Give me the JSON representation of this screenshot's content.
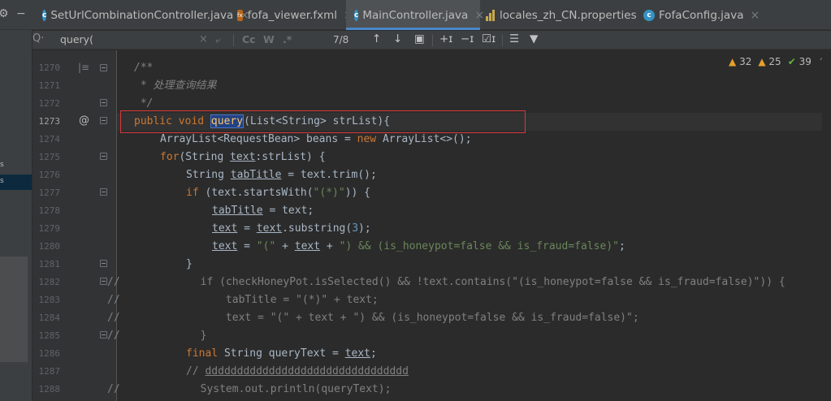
{
  "tabs": [
    {
      "label": "SetUrlCombinationController.java",
      "icon": "class-c-icon",
      "active": false
    },
    {
      "label": "fofa_viewer.fxml",
      "icon": "fxml-icon",
      "active": false
    },
    {
      "label": "MainController.java",
      "icon": "class-c-icon",
      "active": true
    },
    {
      "label": "locales_zh_CN.properties",
      "icon": "properties-icon",
      "active": false
    },
    {
      "label": "FofaConfig.java",
      "icon": "class-c-icon",
      "active": false
    }
  ],
  "find": {
    "query": "query(",
    "count": "7/8",
    "match_case": "Cc",
    "words": "W",
    "regex": ".*"
  },
  "inspections": {
    "warnings": "32",
    "weak_warnings": "25",
    "ok": "39"
  },
  "colors": {
    "accent": "#4a88c7",
    "annotation_box": "#d9383a",
    "match_bg": "#214283"
  },
  "gutter": {
    "line_numbers": [
      "1270",
      "1271",
      "1272",
      "1273",
      "1274",
      "1275",
      "1276",
      "1277",
      "1278",
      "1279",
      "1280",
      "1281",
      "1282",
      "1283",
      "1284",
      "1285",
      "1286",
      "1287",
      "1288"
    ],
    "current_line": "1273",
    "at_marker": "@"
  },
  "code": {
    "l1270": "/**",
    "l1271": " * 处理查询结果",
    "l1272": " */",
    "l1273_kw": "public void ",
    "l1273_fn": "query",
    "l1273_rest": "(List<String> strList){",
    "l1274_a": "ArrayList<RequestBean> beans = ",
    "l1274_kw": "new",
    "l1274_b": " ArrayList<>();",
    "l1275_kw": "for",
    "l1275_a": "(String ",
    "l1275_var": "text",
    "l1275_b": ":strList) {",
    "l1276_a": "String ",
    "l1276_var": "tabTitle",
    "l1276_b": " = text.trim();",
    "l1277_kw": "if",
    "l1277_a": " (text.startsWith(",
    "l1277_str": "\"(*)\"",
    "l1277_b": ")) {",
    "l1278_var": "tabTitle",
    "l1278_b": " = text;",
    "l1279_var": "text",
    "l1279_a": " = ",
    "l1279_var2": "text",
    "l1279_b": ".substring(",
    "l1279_num": "3",
    "l1279_c": ");",
    "l1280_var": "text",
    "l1280_a": " = ",
    "l1280_str1": "\"(\"",
    "l1280_b": " + ",
    "l1280_var2": "text",
    "l1280_c": " + ",
    "l1280_str2": "\") && (is_honeypot=false && is_fraud=false)\"",
    "l1280_d": ";",
    "l1281": "}",
    "l1282_mark": "//",
    "l1282": "      if (checkHoneyPot.isSelected() && !text.contains(\"(is_honeypot=false && is_fraud=false)\")) {",
    "l1283_mark": "//",
    "l1283": "          tabTitle = \"(*)\" + text;",
    "l1284_mark": "//",
    "l1284": "          text = \"(\" + text + \") && (is_honeypot=false && is_fraud=false)\";",
    "l1285_mark": "//",
    "l1285": "      }",
    "l1286_kw": "final",
    "l1286_a": " String queryText = ",
    "l1286_var": "text",
    "l1286_b": ";",
    "l1287_a": "// ",
    "l1287_b": "dddddddddddddddddddddddddddddddd",
    "l1288_mark": "//",
    "l1288": "      System.out.println(queryText);"
  }
}
